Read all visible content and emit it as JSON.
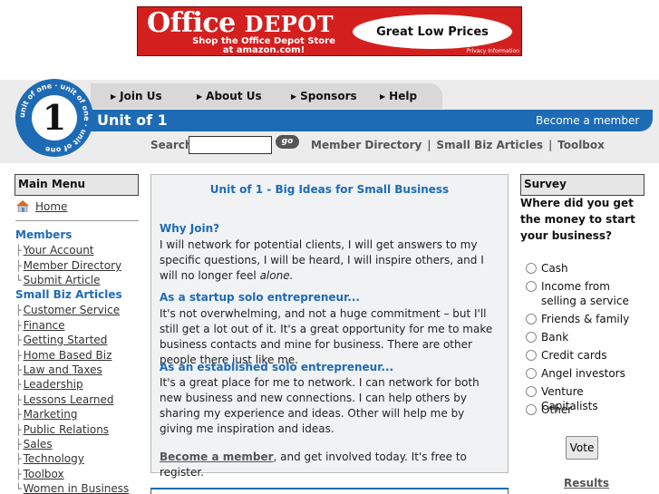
{
  "ad": {
    "brand_main": "Office",
    "brand_sub": "DEPOT",
    "tagline_1": "Shop the Office Depot Store",
    "tagline_2": "at amazon.com!",
    "pill_text": "Great Low Prices",
    "privacy": "Privacy Information"
  },
  "logo": {
    "ring_text": "unit of one · unit of one · unit of one",
    "digit": "1"
  },
  "nav": {
    "items": [
      "Join Us",
      "About Us",
      "Sponsors",
      "Help"
    ]
  },
  "header": {
    "title": "Unit of 1",
    "become_member": "Become a member"
  },
  "search": {
    "label": "Search",
    "value": "",
    "go_label": "go",
    "links": [
      "Member Directory",
      "Small Biz Articles",
      "Toolbox"
    ]
  },
  "left": {
    "main_menu_title": "Main Menu",
    "home": "Home",
    "members_heading": "Members",
    "members_items": [
      "Your Account",
      "Member Directory",
      "Submit Article"
    ],
    "articles_heading": "Small Biz Articles",
    "articles_items": [
      "Customer Service",
      "Finance",
      "Getting Started",
      "Home Based Biz",
      "Law and Taxes",
      "Leadership",
      "Lessons Learned",
      "Marketing",
      "Public Relations",
      "Sales",
      "Technology",
      "Toolbox",
      "Women in Business"
    ]
  },
  "main": {
    "title": "Unit of 1 - Big Ideas for Small Business",
    "sections": [
      {
        "heading": "Why Join?",
        "text": "I will network for potential clients, I will get answers to my specific questions, I will be heard, I will inspire others, and I will no longer feel ",
        "emph": "alone."
      },
      {
        "heading": "As a startup solo entrepreneur...",
        "text": "It's not overwhelming, and not a huge commitment – but I'll still get a lot out of it. It's a great opportunity for me to make business contacts and mine for business. There are other people there just like me."
      },
      {
        "heading": "As an established solo entrepreneur...",
        "text": "It's a great place for me to network. I can network for both new business and new connections. I can help others by sharing my experience and ideas. Other will help me by giving me inspiration and ideas."
      }
    ],
    "cta_link": "Become a member",
    "cta_rest": ", and get involved today. It's free to register."
  },
  "survey": {
    "title": "Survey",
    "question": "Where did you get the money to start your business?",
    "options": [
      "Cash",
      "Income from selling a service",
      "Friends & family",
      "Bank",
      "Credit cards",
      "Angel investors",
      "Venture Capitalists",
      "Other"
    ],
    "vote_label": "Vote",
    "results_label": "Results"
  },
  "colors": {
    "brand_blue": "#1e6bb5",
    "ad_red": "#d41f1f",
    "header_gray": "#ececec"
  }
}
